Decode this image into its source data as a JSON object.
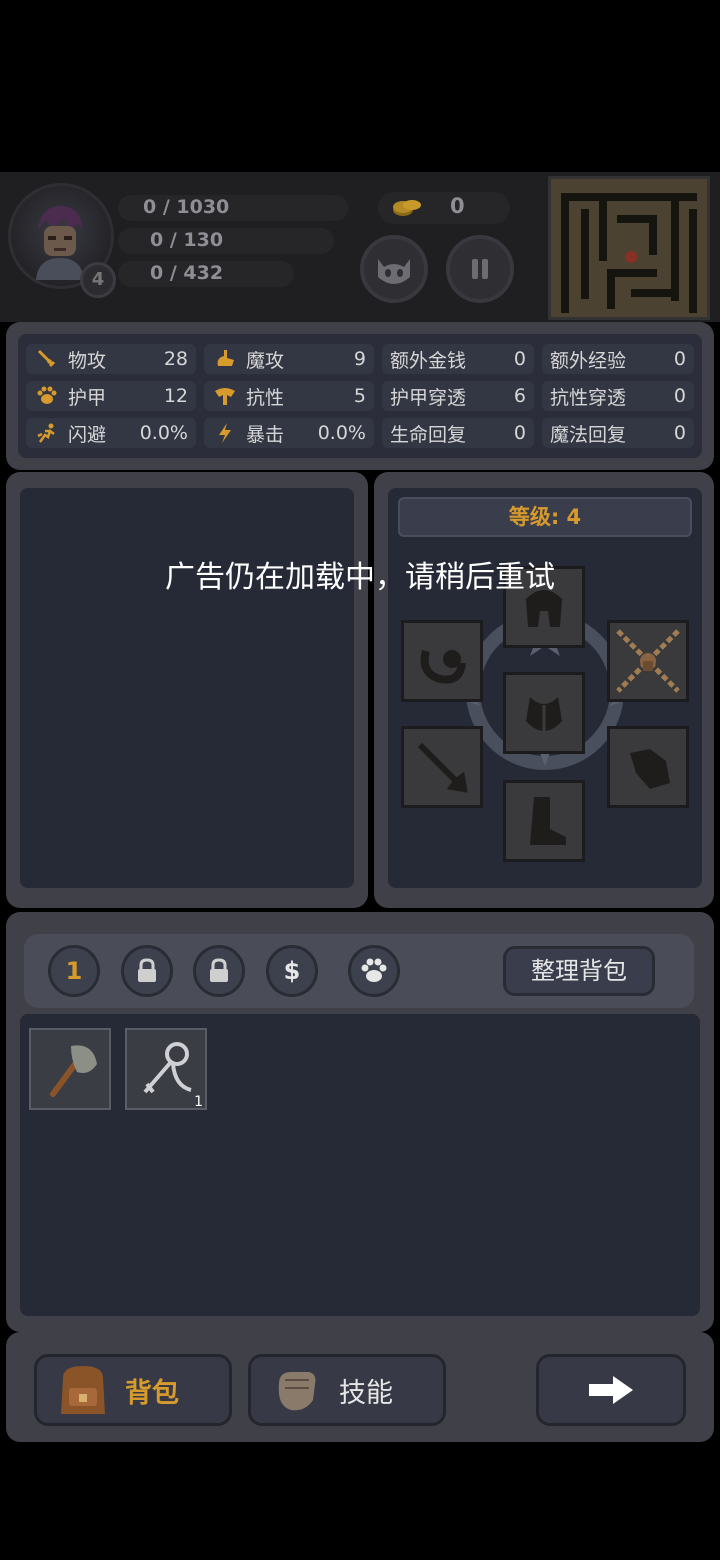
{
  "hud": {
    "hp_text": "0 / 1030",
    "mp_text": "0 / 130",
    "exp_text": "0 / 432",
    "level": "4",
    "gold": "0"
  },
  "stats": [
    {
      "label": "物攻",
      "value": "28",
      "icon": "sword-icon"
    },
    {
      "label": "魔攻",
      "value": "9",
      "icon": "magic-hand-icon"
    },
    {
      "label": "额外金钱",
      "value": "0",
      "icon": ""
    },
    {
      "label": "额外经验",
      "value": "0",
      "icon": ""
    },
    {
      "label": "护甲",
      "value": "12",
      "icon": "armor-icon"
    },
    {
      "label": "抗性",
      "value": "5",
      "icon": "resist-icon"
    },
    {
      "label": "护甲穿透",
      "value": "6",
      "icon": ""
    },
    {
      "label": "抗性穿透",
      "value": "0",
      "icon": ""
    },
    {
      "label": "闪避",
      "value": "0.0%",
      "icon": "dodge-icon"
    },
    {
      "label": "暴击",
      "value": "0.0%",
      "icon": "lightning-icon"
    },
    {
      "label": "生命回复",
      "value": "0",
      "icon": ""
    },
    {
      "label": "魔法回复",
      "value": "0",
      "icon": ""
    }
  ],
  "equipment": {
    "level_label": "等级: 4"
  },
  "toast": "广告仍在加载中，请稍后重试",
  "bag_tabs": {
    "first_tab": "1",
    "sort_button": "整理背包"
  },
  "items": [
    {
      "name": "axe"
    },
    {
      "name": "hook-key",
      "count": "1"
    }
  ],
  "bottom_nav": {
    "bag_label": "背包",
    "skill_label": "技能"
  },
  "colors": {
    "accent": "#d79a2c",
    "panel": "#262936",
    "frame": "#3f4048"
  }
}
